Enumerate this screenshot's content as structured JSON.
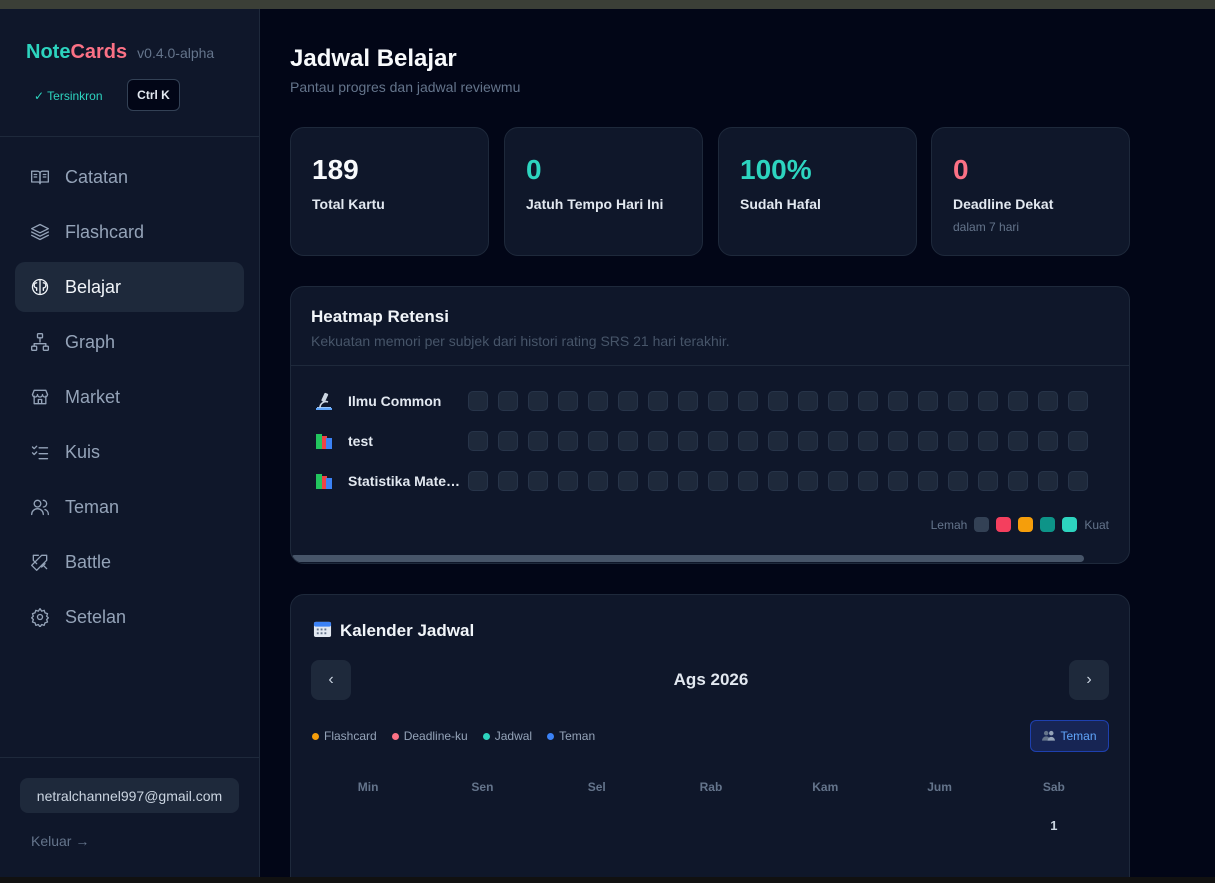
{
  "app": {
    "name_part1": "Note",
    "name_part2": "Cards",
    "version": "v0.4.0-alpha",
    "sync_status": "✓ Tersinkron",
    "shortcut": "Ctrl K"
  },
  "sidebar": {
    "items": [
      {
        "label": "Catatan",
        "icon": "book-open-icon",
        "active": false
      },
      {
        "label": "Flashcard",
        "icon": "layers-icon",
        "active": false
      },
      {
        "label": "Belajar",
        "icon": "brain-icon",
        "active": true
      },
      {
        "label": "Graph",
        "icon": "network-icon",
        "active": false
      },
      {
        "label": "Market",
        "icon": "store-icon",
        "active": false
      },
      {
        "label": "Kuis",
        "icon": "checklist-icon",
        "active": false
      },
      {
        "label": "Teman",
        "icon": "users-icon",
        "active": false
      },
      {
        "label": "Battle",
        "icon": "swords-icon",
        "active": false
      },
      {
        "label": "Setelan",
        "icon": "gear-icon",
        "active": false
      }
    ],
    "email": "netralchannel997@gmail.com",
    "logout": "Keluar →"
  },
  "page": {
    "title": "Jadwal Belajar",
    "subtitle": "Pantau progres dan jadwal reviewmu"
  },
  "stats": [
    {
      "value": "189",
      "label": "Total Kartu",
      "note": "",
      "color": "#f8fafc"
    },
    {
      "value": "0",
      "label": "Jatuh Tempo Hari Ini",
      "note": "",
      "color": "#2dd4bf"
    },
    {
      "value": "100%",
      "label": "Sudah Hafal",
      "note": "",
      "color": "#2dd4bf"
    },
    {
      "value": "0",
      "label": "Deadline Dekat",
      "note": "dalam 7 hari",
      "color": "#fb7185"
    }
  ],
  "heatmap": {
    "title": "Heatmap Retensi",
    "subtitle": "Kekuatan memori per subjek dari histori rating SRS 21 hari terakhir.",
    "subjects": [
      {
        "name": "Ilmu Common",
        "icon": "microscope-icon"
      },
      {
        "name": "test",
        "icon": "books-icon"
      },
      {
        "name": "Statistika Matematika",
        "icon": "books-icon"
      }
    ],
    "days": 21,
    "legend_weak": "Lemah",
    "legend_strong": "Kuat",
    "legend_colors": [
      "#334155",
      "#f43f5e",
      "#f59e0b",
      "#0d9488",
      "#2dd4bf"
    ],
    "empty_color": "#1e293b"
  },
  "calendar": {
    "title": "Kalender Jadwal",
    "month": "Ags 2026",
    "prev": "‹",
    "next": "›",
    "legend": [
      {
        "label": "Flashcard",
        "color": "#f59e0b"
      },
      {
        "label": "Deadline-ku",
        "color": "#fb7185"
      },
      {
        "label": "Jadwal",
        "color": "#2dd4bf"
      },
      {
        "label": "Teman",
        "color": "#3b82f6"
      }
    ],
    "friends_button": "Teman",
    "weekdays": [
      "Min",
      "Sen",
      "Sel",
      "Rab",
      "Kam",
      "Jum",
      "Sab"
    ],
    "first_row": [
      "",
      "",
      "",
      "",
      "",
      "",
      "1"
    ]
  }
}
